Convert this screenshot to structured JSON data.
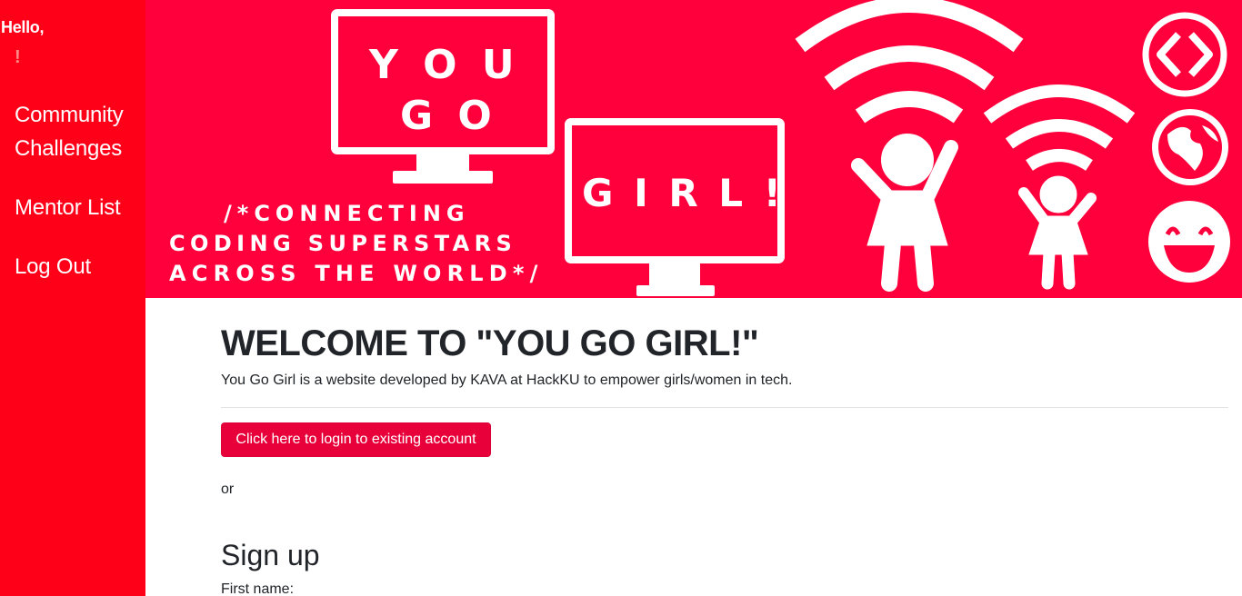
{
  "sidebar": {
    "greeting": "Hello,",
    "user_name": "!",
    "nav": [
      {
        "label": "Community Challenges"
      },
      {
        "label": "Mentor List"
      },
      {
        "label": "Log Out"
      }
    ]
  },
  "banner": {
    "monitor1_line1": "Y O U",
    "monitor1_line2": "G O",
    "monitor2_text": "G I R L !",
    "tagline_line1": "/*CONNECTING",
    "tagline_line2": "CODING SUPERSTARS",
    "tagline_line3": "ACROSS THE WORLD*/",
    "icons": [
      "code-icon",
      "globe-icon",
      "smiley-icon",
      "wifi-icon",
      "girl-figure-icon"
    ],
    "colors": {
      "background": "#ff003c",
      "foreground": "#ffffff"
    }
  },
  "main": {
    "title": "WELCOME TO \"YOU GO GIRL!\"",
    "description": "You Go Girl is a website developed by KAVA at HackKU to empower girls/women in tech.",
    "login_button": "Click here to login to existing account",
    "or_text": "or",
    "signup_title": "Sign up",
    "first_name_label": "First name:"
  },
  "colors": {
    "sidebar": "#ff0019",
    "button": "#e8003a"
  }
}
